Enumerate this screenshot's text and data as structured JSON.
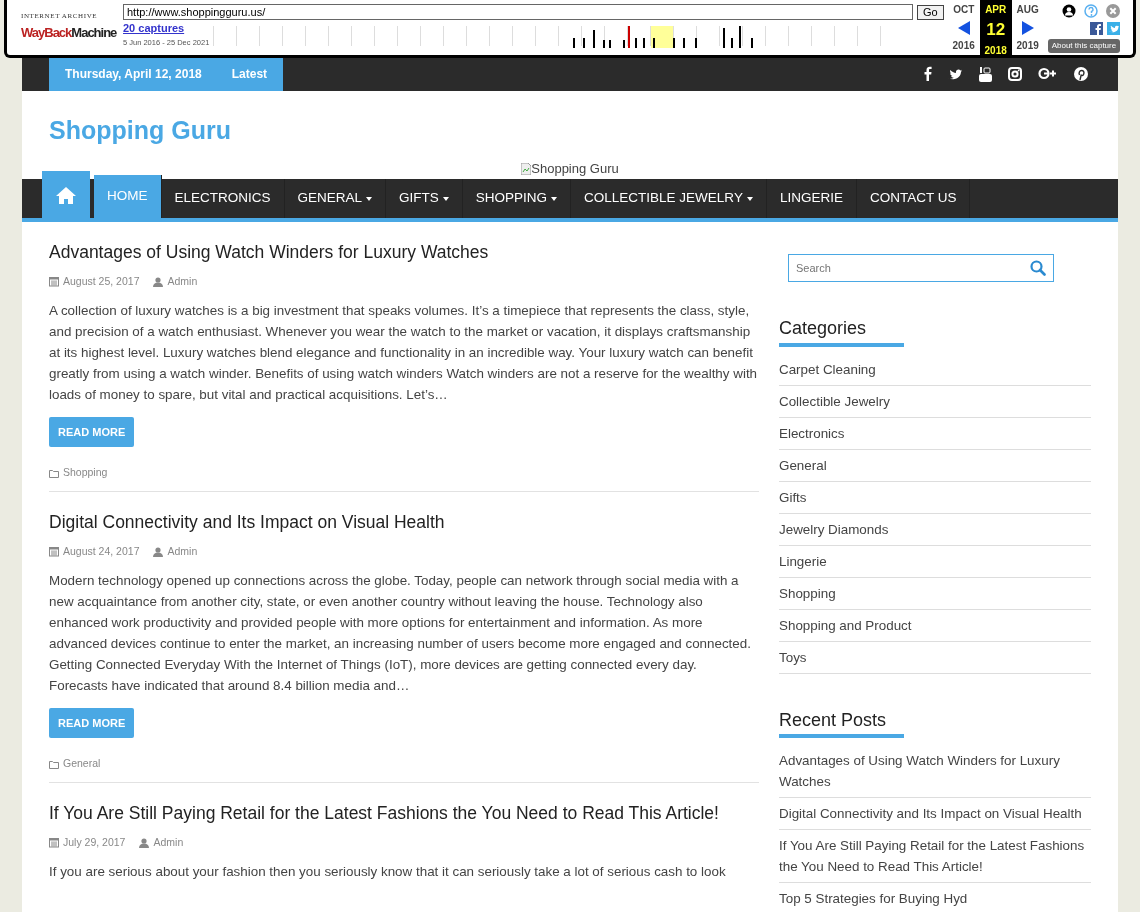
{
  "wayback": {
    "logo_top": "INTERNET ARCHIVE",
    "logo_red": "WayBack",
    "logo_black": "Machine",
    "url": "http://www.shoppingguru.us/",
    "go": "Go",
    "captures": "20 captures",
    "range": "5 Jun 2016 - 25 Dec 2021",
    "about": "About this capture",
    "months": [
      {
        "month": "OCT",
        "year": "2016",
        "selected": false
      },
      {
        "month": "APR",
        "day": "12",
        "year": "2018",
        "selected": true
      },
      {
        "month": "AUG",
        "year": "2019",
        "selected": false
      }
    ]
  },
  "topbar": {
    "date": "Thursday, April 12, 2018",
    "latest": "Latest"
  },
  "site_title": "Shopping Guru",
  "header_image_alt": "Shopping Guru",
  "nav": [
    {
      "label": "HOME",
      "dropdown": false,
      "selected": true
    },
    {
      "label": "ELECTRONICS",
      "dropdown": false,
      "selected": false
    },
    {
      "label": "GENERAL",
      "dropdown": true,
      "selected": false
    },
    {
      "label": "GIFTS",
      "dropdown": true,
      "selected": false
    },
    {
      "label": "SHOPPING",
      "dropdown": true,
      "selected": false
    },
    {
      "label": "COLLECTIBLE JEWELRY",
      "dropdown": true,
      "selected": false
    },
    {
      "label": "LINGERIE",
      "dropdown": false,
      "selected": false
    },
    {
      "label": "CONTACT US",
      "dropdown": false,
      "selected": false
    }
  ],
  "posts": [
    {
      "title": "Advantages of Using Watch Winders for Luxury Watches",
      "date": "August 25, 2017",
      "author": "Admin",
      "excerpt": "A collection of luxury watches is a big investment that speaks volumes. It’s a timepiece that represents the class, style, and precision of a watch enthusiast. Whenever you wear the watch to the market or vacation, it displays craftsmanship at its highest level. Luxury watches blend elegance and functionality in an incredible way. Your luxury watch can benefit greatly from using a watch winder. Benefits of using watch winders Watch winders are not a reserve for the wealthy with loads of money to spare, but vital and practical acquisitions. Let’s…",
      "button": "READ MORE",
      "category": "Shopping"
    },
    {
      "title": "Digital Connectivity and Its Impact on Visual Health",
      "date": "August 24, 2017",
      "author": "Admin",
      "excerpt": "Modern technology opened up connections across the globe. Today, people can network through social media with a new acquaintance from another city, state, or even another country without leaving the house. Technology also enhanced work productivity and provided people with more options for entertainment and information. As more advanced devices continue to enter the market, an increasing number of users become more engaged and connected. Getting Connected Everyday With the Internet of Things (IoT), more devices are getting connected every day. Forecasts have indicated that around 8.4 billion media and…",
      "button": "READ MORE",
      "category": "General"
    },
    {
      "title": "If You Are Still Paying Retail for the Latest Fashions the You Need to Read This Article!",
      "date": "July 29, 2017",
      "author": "Admin",
      "excerpt": "If you are serious about your fashion then you seriously know that it can seriously take a lot of serious cash to look"
    }
  ],
  "sidebar": {
    "search_placeholder": "Search",
    "categories": {
      "title": "Categories",
      "items": [
        "Carpet Cleaning",
        "Collectible Jewelry",
        "Electronics",
        "General",
        "Gifts",
        "Jewelry Diamonds",
        "Lingerie",
        "Shopping",
        "Shopping and Product",
        "Toys"
      ]
    },
    "recent": {
      "title": "Recent Posts",
      "items": [
        "Advantages of Using Watch Winders for Luxury Watches",
        "Digital Connectivity and Its Impact on Visual Health",
        "If You Are Still Paying Retail for the Latest Fashions the You Need to Read This Article!",
        "Top 5 Strategies for Buying Hyd"
      ]
    }
  }
}
